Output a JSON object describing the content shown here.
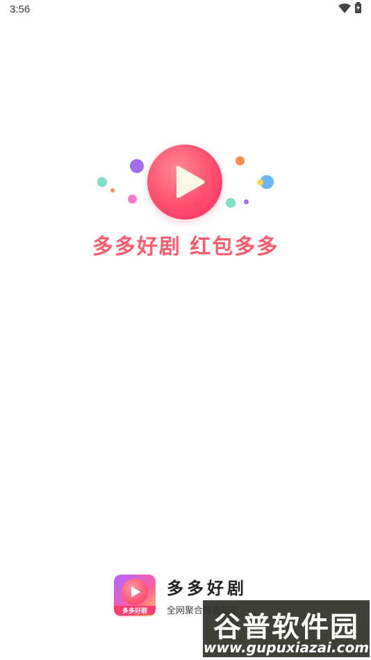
{
  "status_bar": {
    "time": "3:56",
    "icons": [
      "wifi-icon",
      "battery-icon"
    ]
  },
  "splash": {
    "slogan": "多多好剧 红包多多",
    "logo_icon": "play-icon",
    "colors": {
      "accent": "#ff5a6e",
      "logo": "#ff4d6d"
    }
  },
  "footer": {
    "app_icon_label": "多多好剧",
    "app_name": "多多好剧",
    "tagline": "全网聚合海量短剧"
  },
  "watermark": {
    "brand": "谷普软件园",
    "url": "www.gupuxiazai.com"
  }
}
